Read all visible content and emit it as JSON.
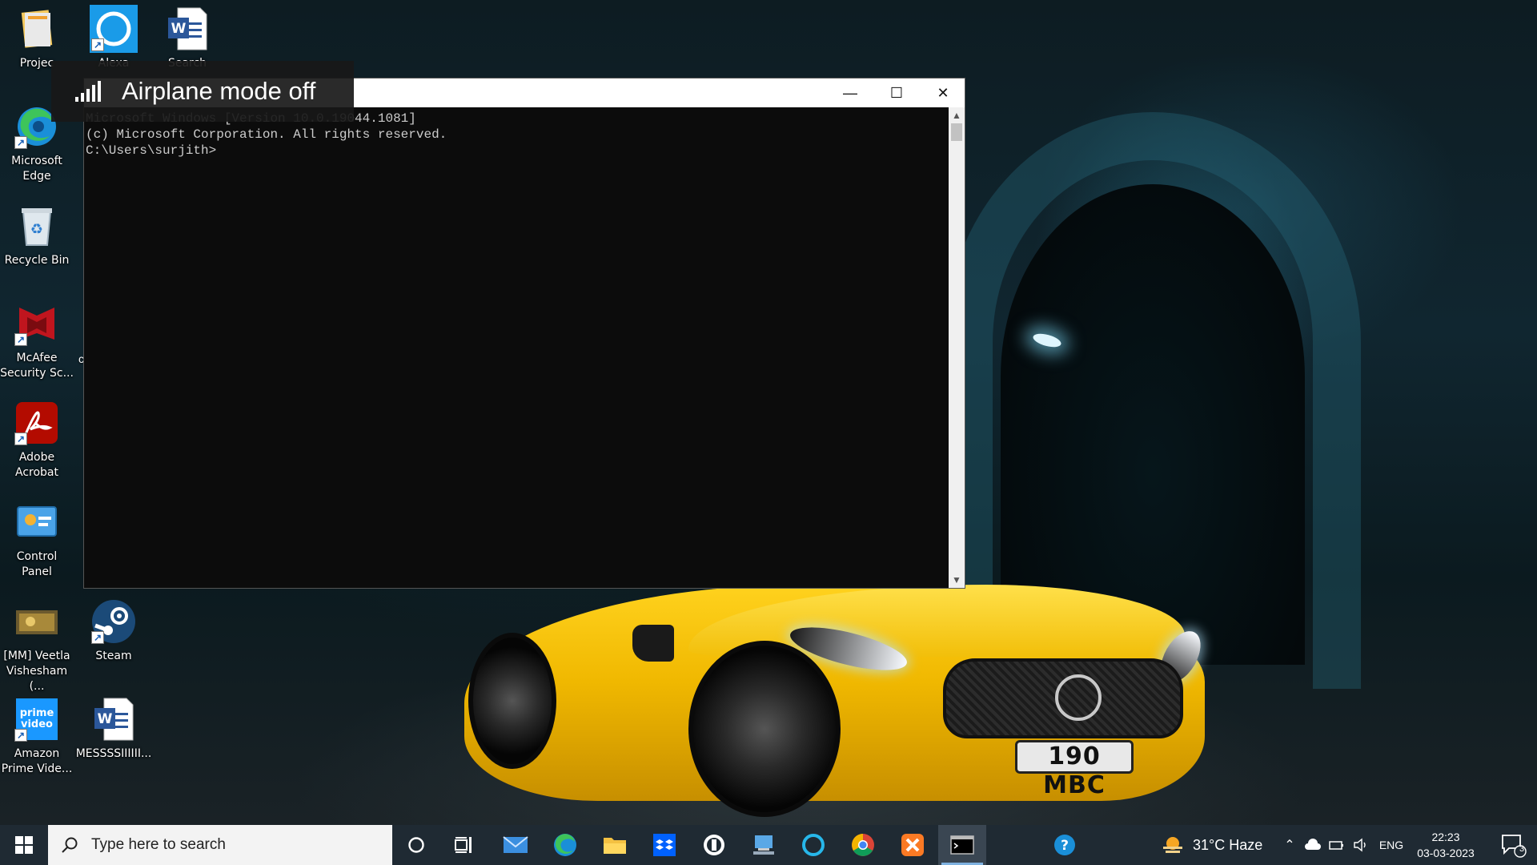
{
  "desktop": {
    "icons": [
      {
        "label": "Projec",
        "icon": "folder-icon"
      },
      {
        "label": "Alexa",
        "icon": "alexa-icon"
      },
      {
        "label": "Search",
        "icon": "word-doc-icon"
      },
      {
        "label": "Microsoft Edge",
        "icon": "edge-icon"
      },
      {
        "label": "Recycle Bin",
        "icon": "recycle-bin-icon"
      },
      {
        "label": "McAfee Security Sc...",
        "icon": "mcafee-icon"
      },
      {
        "label": "Adobe Acrobat",
        "icon": "acrobat-icon"
      },
      {
        "label": "Control Panel",
        "icon": "control-panel-icon"
      },
      {
        "label": "[MM] Veetla Vishesham (...",
        "icon": "video-thumbnail-icon"
      },
      {
        "label": "Steam",
        "icon": "steam-icon"
      },
      {
        "label": "Amazon Prime Vide...",
        "icon": "prime-video-icon"
      },
      {
        "label": "MESSSSIIIIII...",
        "icon": "word-doc-icon"
      }
    ],
    "partial_label_c": "c",
    "plate_text": "190 MBC"
  },
  "airplane_toast": {
    "text": "Airplane mode off",
    "icon": "signal-bars-icon"
  },
  "cmd": {
    "lines": [
      "Microsoft Windows [Version 10.0.19044.1081]",
      "(c) Microsoft Corporation. All rights reserved.",
      "",
      "C:\\Users\\surjith>"
    ],
    "buttons": {
      "minimize": "—",
      "maximize": "☐",
      "close": "✕"
    }
  },
  "taskbar": {
    "search_placeholder": "Type here to search",
    "weather": "31°C  Haze",
    "language": "ENG",
    "time": "22:23",
    "date": "03-03-2023",
    "notification_count": "3",
    "pinned": [
      "cortana-icon",
      "task-view-icon",
      "mail-icon",
      "edge-icon",
      "file-explorer-icon",
      "dropbox-icon",
      "app-icon",
      "desktop-app-icon",
      "alexa-icon",
      "chrome-icon",
      "xampp-icon",
      "cmd-icon",
      "help-icon"
    ]
  },
  "colors": {
    "taskbar": "#1f2a33",
    "cmd_bg": "#0c0c0c",
    "cmd_text": "#cccccc",
    "active_indicator": "#7fb2e0"
  }
}
